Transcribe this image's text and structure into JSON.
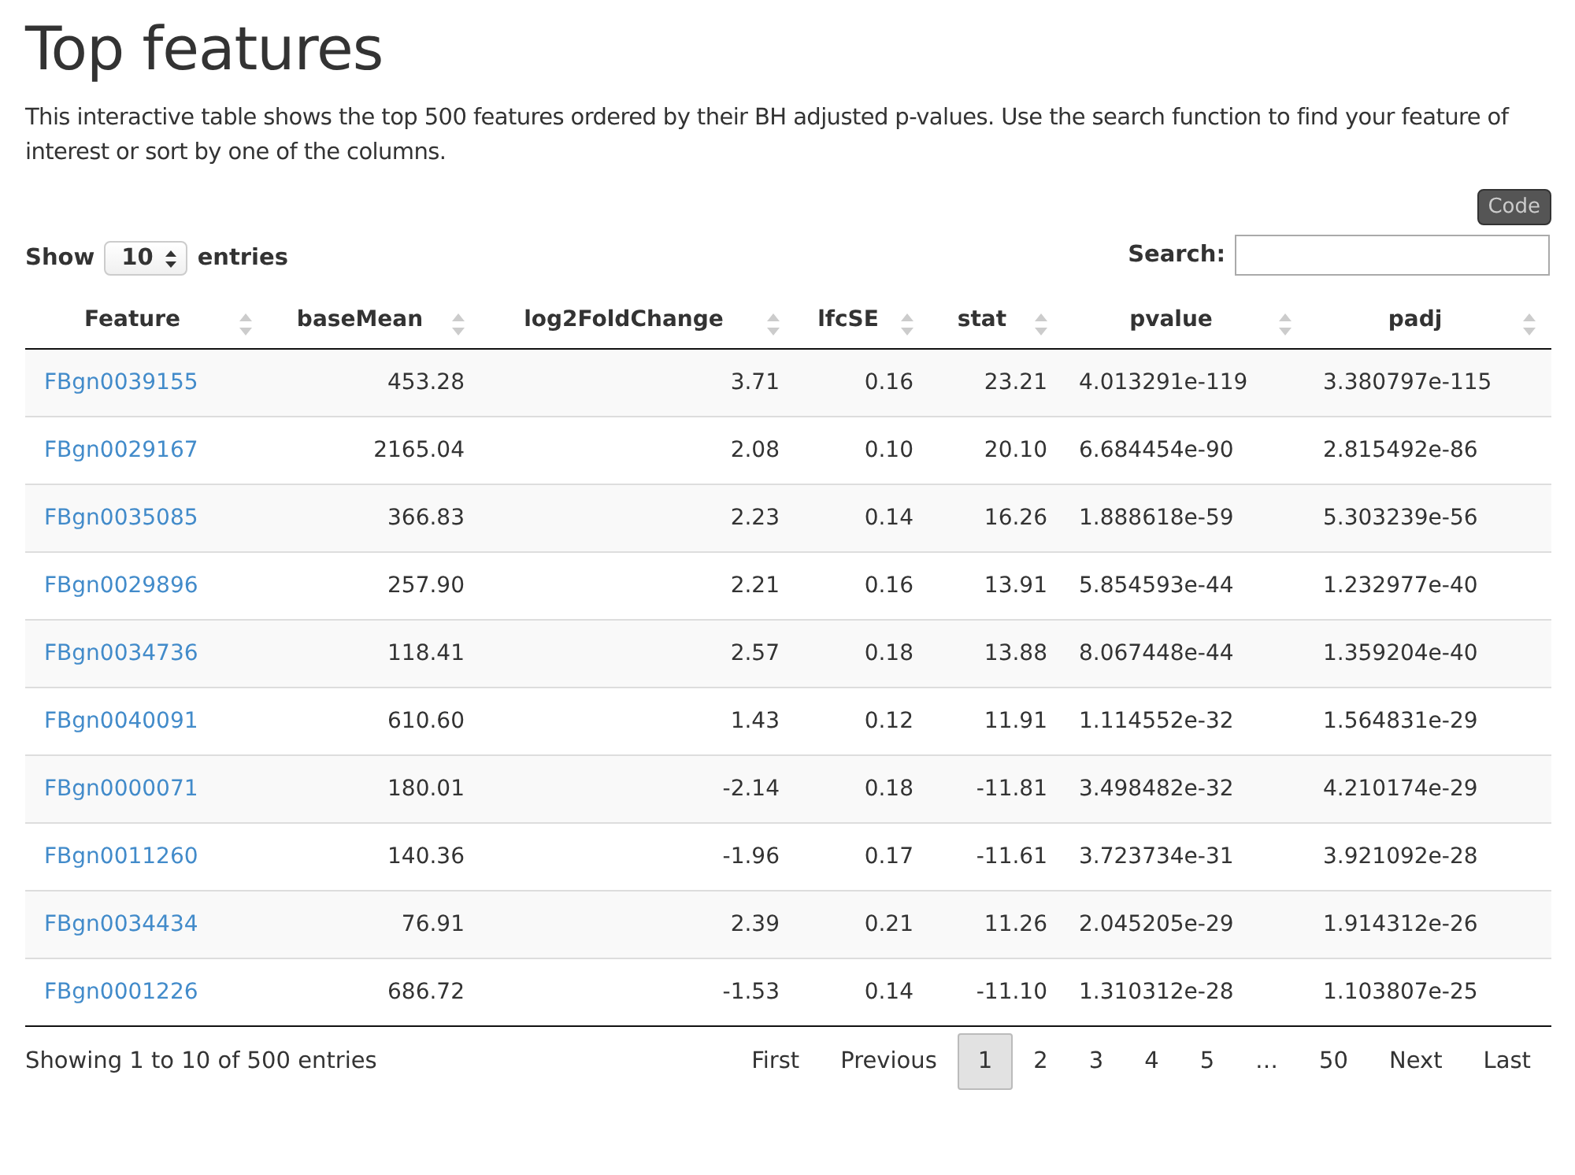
{
  "title": "Top features",
  "description": "This interactive table shows the top 500 features ordered by their BH adjusted p-values. Use the search function to find your feature of interest or sort by one of the columns.",
  "code_button": "Code",
  "length": {
    "before": "Show",
    "value": "10",
    "after": "entries"
  },
  "search": {
    "label": "Search:"
  },
  "columns": [
    "Feature",
    "baseMean",
    "log2FoldChange",
    "lfcSE",
    "stat",
    "pvalue",
    "padj"
  ],
  "rows": [
    [
      "FBgn0039155",
      "453.28",
      "3.71",
      "0.16",
      "23.21",
      "4.013291e-119",
      "3.380797e-115"
    ],
    [
      "FBgn0029167",
      "2165.04",
      "2.08",
      "0.10",
      "20.10",
      "6.684454e-90",
      "2.815492e-86"
    ],
    [
      "FBgn0035085",
      "366.83",
      "2.23",
      "0.14",
      "16.26",
      "1.888618e-59",
      "5.303239e-56"
    ],
    [
      "FBgn0029896",
      "257.90",
      "2.21",
      "0.16",
      "13.91",
      "5.854593e-44",
      "1.232977e-40"
    ],
    [
      "FBgn0034736",
      "118.41",
      "2.57",
      "0.18",
      "13.88",
      "8.067448e-44",
      "1.359204e-40"
    ],
    [
      "FBgn0040091",
      "610.60",
      "1.43",
      "0.12",
      "11.91",
      "1.114552e-32",
      "1.564831e-29"
    ],
    [
      "FBgn0000071",
      "180.01",
      "-2.14",
      "0.18",
      "-11.81",
      "3.498482e-32",
      "4.210174e-29"
    ],
    [
      "FBgn0011260",
      "140.36",
      "-1.96",
      "0.17",
      "-11.61",
      "3.723734e-31",
      "3.921092e-28"
    ],
    [
      "FBgn0034434",
      "76.91",
      "2.39",
      "0.21",
      "11.26",
      "2.045205e-29",
      "1.914312e-26"
    ],
    [
      "FBgn0001226",
      "686.72",
      "-1.53",
      "0.14",
      "-11.10",
      "1.310312e-28",
      "1.103807e-25"
    ]
  ],
  "info": "Showing 1 to 10 of 500 entries",
  "pagination": [
    {
      "label": "First",
      "selected": false
    },
    {
      "label": "Previous",
      "selected": false
    },
    {
      "label": "1",
      "selected": true
    },
    {
      "label": "2",
      "selected": false
    },
    {
      "label": "3",
      "selected": false
    },
    {
      "label": "4",
      "selected": false
    },
    {
      "label": "5",
      "selected": false
    },
    {
      "label": "…",
      "selected": false
    },
    {
      "label": "50",
      "selected": false
    },
    {
      "label": "Next",
      "selected": false
    },
    {
      "label": "Last",
      "selected": false
    }
  ]
}
